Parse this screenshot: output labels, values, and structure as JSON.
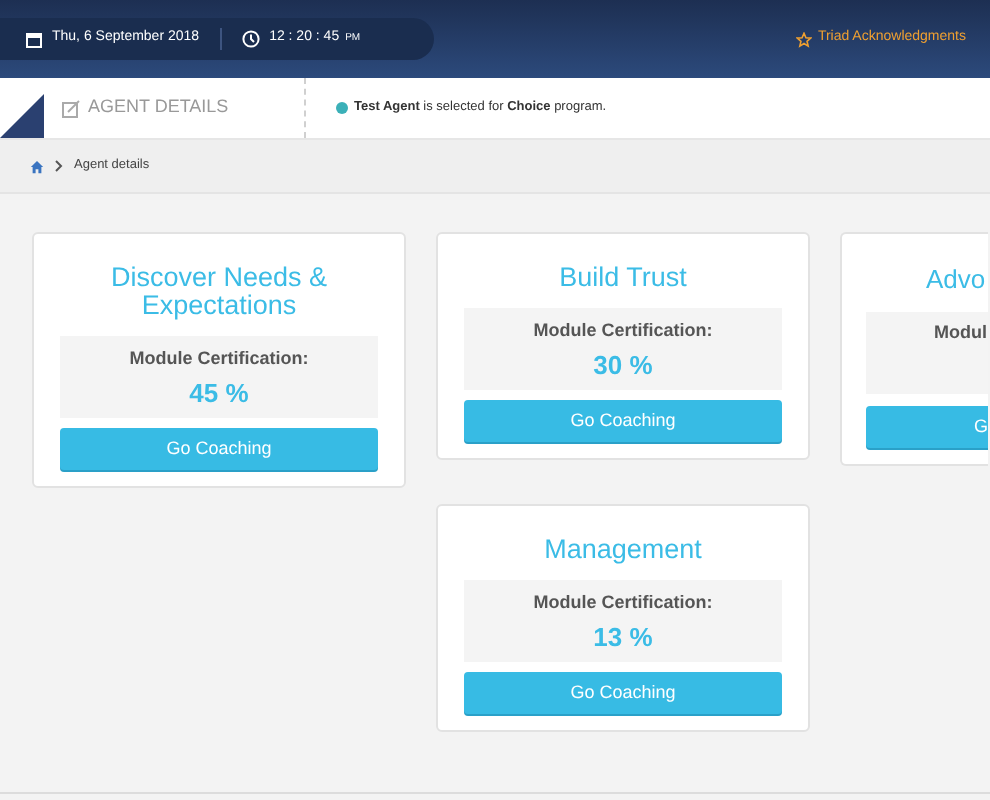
{
  "top_bar": {
    "date": "Thu, 6 September 2018",
    "time": "12 : 20 : 45",
    "meridiem": "PM",
    "acknowledgments_link": "Triad Acknowledgments"
  },
  "sub_header": {
    "title": "AGENT DETAILS",
    "message": "**Test Agent** is selected for **Choice** program."
  },
  "breadcrumb": {
    "current": "Agent details"
  },
  "modules": [
    {
      "title": "Discover Needs & Expectations",
      "certification_label": "Module Certification:",
      "certification_value": "45 %",
      "button": "Go Coaching",
      "cut_off": false
    },
    {
      "title": "Build Trust",
      "certification_label": "Module Certification:",
      "certification_value": "30 %",
      "button": "Go Coaching",
      "cut_off": false
    },
    {
      "title": "Advo",
      "certification_label": "Modul",
      "button": "G",
      "cut_off": true
    },
    {
      "title": "Management",
      "certification_label": "Module Certification:",
      "certification_value": "13 %",
      "button": "Go Coaching",
      "cut_off": false
    }
  ]
}
